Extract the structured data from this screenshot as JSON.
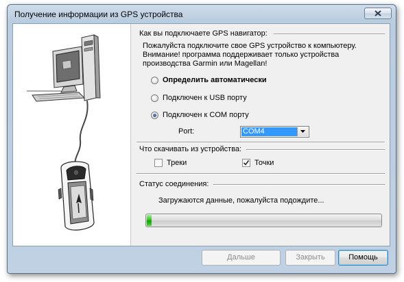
{
  "window": {
    "title": "Получение информации из GPS устройства"
  },
  "connection": {
    "heading": "Как вы подключаете GPS навигатор:",
    "instruction_1": "Пожалуйста подключите свое GPS устройство к компьютеру.",
    "instruction_2": "Внимание! программа поддерживает только устройства",
    "instruction_3": "производства Garmin или Magellan!",
    "options": [
      {
        "label": "Определить автоматически",
        "checked": false
      },
      {
        "label": "Подключен к USB порту",
        "checked": false
      },
      {
        "label": "Подключен к COM порту",
        "checked": true
      }
    ],
    "port_label": "Port:",
    "port_value": "COM4"
  },
  "download": {
    "heading": "Что скачивать из устройства:",
    "tracks_label": "Треки",
    "tracks_checked": false,
    "points_label": "Точки",
    "points_checked": true
  },
  "status": {
    "heading": "Статус соединения:",
    "message": "Загружаются данные, пожалуйста подождите...",
    "progress": 0.02
  },
  "buttons": {
    "next": "Дальше",
    "close": "Закрыть",
    "help": "Помощь"
  },
  "colors": {
    "progress_fill": "#14a20a",
    "selection": "#3399ff"
  }
}
